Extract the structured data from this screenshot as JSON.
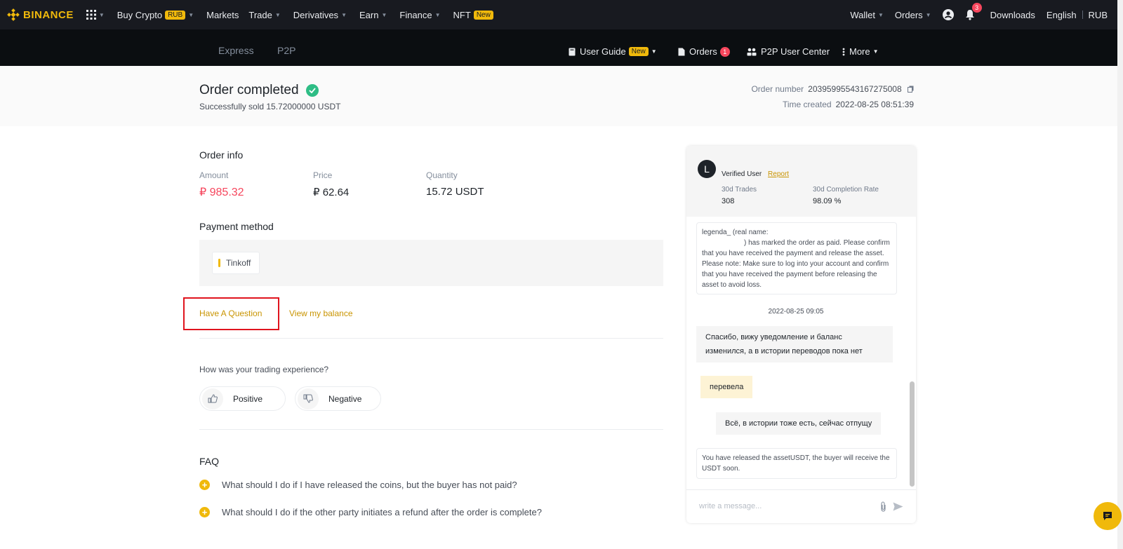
{
  "topnav": {
    "logo": "BINANCE",
    "items": [
      {
        "label": "Buy Crypto",
        "pill": "RUB"
      },
      {
        "label": "Markets"
      },
      {
        "label": "Trade"
      },
      {
        "label": "Derivatives"
      },
      {
        "label": "Earn"
      },
      {
        "label": "Finance"
      },
      {
        "label": "NFT",
        "pill": "New"
      }
    ],
    "right": {
      "wallet": "Wallet",
      "orders": "Orders",
      "notifications": "3",
      "downloads": "Downloads",
      "language": "English",
      "currency": "RUB"
    }
  },
  "subnav": {
    "tabs": [
      "Express",
      "P2P"
    ],
    "user_guide": "User Guide",
    "user_guide_pill": "New",
    "orders": "Orders",
    "orders_badge": "1",
    "p2p_center": "P2P User Center",
    "more": "More"
  },
  "order": {
    "title": "Order completed",
    "subtitle": "Successfully sold 15.72000000 USDT",
    "number_label": "Order number",
    "number": "20395995543167275008",
    "time_label": "Time created",
    "time": "2022-08-25 08:51:39"
  },
  "info": {
    "title": "Order info",
    "amount_label": "Amount",
    "amount": "₽ 985.32",
    "price_label": "Price",
    "price": "₽ 62.64",
    "quantity_label": "Quantity",
    "quantity": "15.72 USDT"
  },
  "payment": {
    "title": "Payment method",
    "method": "Tinkoff"
  },
  "links": {
    "question": "Have A Question",
    "balance": "View my balance"
  },
  "feedback": {
    "question": "How was your trading experience?",
    "positive": "Positive",
    "negative": "Negative"
  },
  "faq": {
    "title": "FAQ",
    "items": [
      "What should I do if I have released the coins, but the buyer has not paid?",
      "What should I do if the other party initiates a refund after the order is complete?"
    ]
  },
  "chat": {
    "avatar": "L",
    "verified": "Verified User",
    "report": "Report",
    "trades_label": "30d Trades",
    "trades": "308",
    "rate_label": "30d Completion Rate",
    "rate": "98.09 %",
    "system_msg_1a": "legenda_  (real name:",
    "system_msg_1b": ") has marked the order as paid. Please confirm that you have received the payment and release the asset. Please note: Make sure to log into your account and confirm that you have received the payment before releasing the asset to avoid loss.",
    "timestamp": "2022-08-25 09:05",
    "msg_1": "Спасибо, вижу уведомление и баланс изменился, а в истории переводов пока нет",
    "msg_2": "перевела",
    "msg_3": "Всё, в истории тоже есть, сейчас отпущу",
    "system_msg_2": "You have released the assetUSDT, the buyer will receive the USDT soon.",
    "input_placeholder": "write a message..."
  },
  "colors": {
    "brand": "#f0b90b",
    "sell_red": "#f6465d",
    "success": "#2ebd85",
    "link": "#c99400"
  }
}
